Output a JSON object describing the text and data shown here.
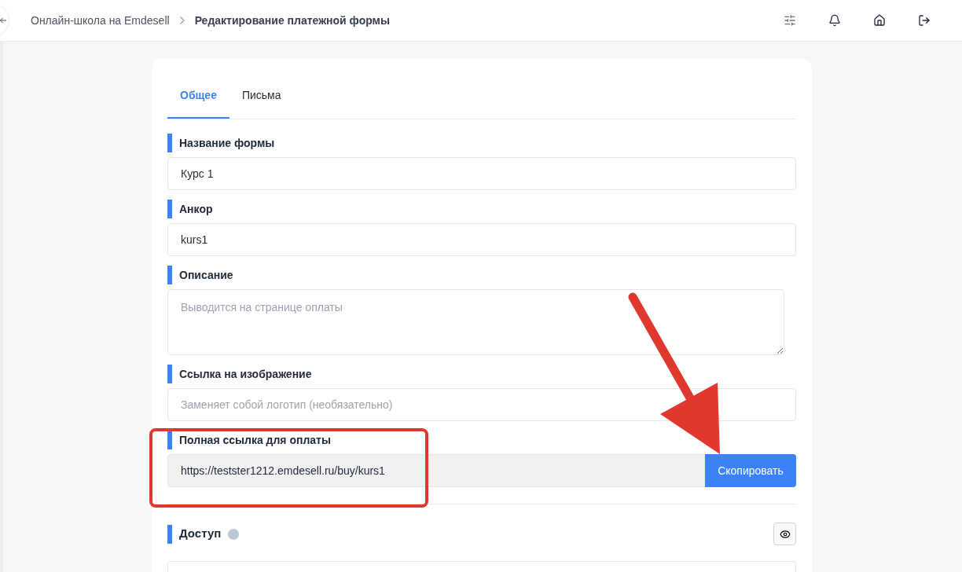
{
  "breadcrumb": {
    "parent": "Онлайн-школа на Emdesell",
    "current": "Редактирование платежной формы"
  },
  "tabs": [
    {
      "label": "Общее",
      "selected": true
    },
    {
      "label": "Письма",
      "selected": false
    }
  ],
  "fields": [
    {
      "kind": "text",
      "label": "Название формы",
      "value": "Курс 1"
    },
    {
      "kind": "text",
      "label": "Анкор",
      "value": "kurs1"
    },
    {
      "kind": "textarea",
      "label": "Описание",
      "placeholder": "Выводится на странице оплаты"
    },
    {
      "kind": "text",
      "label": "Ссылка на изображение",
      "placeholder": "Заменяет собой логотип (необязательно)"
    },
    {
      "kind": "copy",
      "label": "Полная ссылка для оплаты",
      "value": "https://testster1212.emdesell.ru/buy/kurs1",
      "button": "Скопировать"
    }
  ],
  "access": {
    "label": "Доступ"
  },
  "annotations": {
    "frame": true,
    "arrow": true
  }
}
